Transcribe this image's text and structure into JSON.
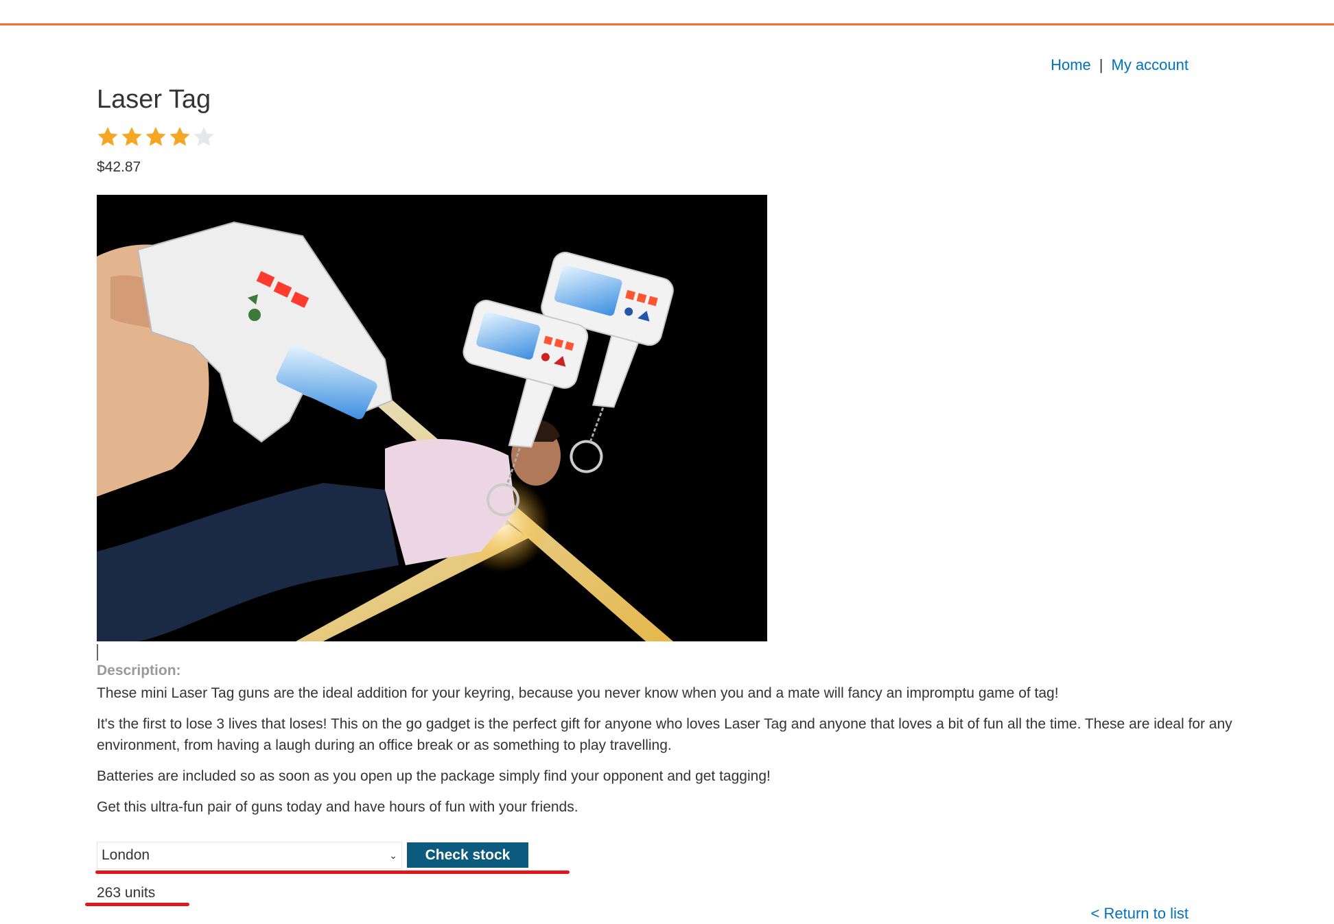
{
  "nav": {
    "home": "Home",
    "separator": "|",
    "my_account": "My account"
  },
  "product": {
    "title": "Laser Tag",
    "rating": 4,
    "rating_max": 5,
    "price": "$42.87",
    "image_alt": "Laser Tag product photo"
  },
  "description": {
    "label": "Description:",
    "paragraphs": [
      "These mini Laser Tag guns are the ideal addition for your keyring, because you never know when you and a mate will fancy an impromptu game of tag!",
      "It's the first to lose 3 lives that loses! This on the go gadget is the perfect gift for anyone who loves Laser Tag and anyone that loves a bit of fun all the time. These are ideal for any environment, from having a laugh during an office break or as something to play travelling.",
      "Batteries are included so as soon as you open up the package simply find your opponent and get tagging!",
      "Get this ultra-fun pair of guns today and have hours of fun with your friends."
    ]
  },
  "stock": {
    "selected_store": "London",
    "check_button": "Check stock",
    "result": "263 units"
  },
  "footer": {
    "return_link": "< Return to list"
  },
  "colors": {
    "accent_orange": "#ff6633",
    "link_blue": "#0071bc",
    "button_bg": "#0c5a7d",
    "annotation_red": "#e3161b",
    "star_filled": "#f5a623",
    "star_empty": "#e5e8e8"
  }
}
